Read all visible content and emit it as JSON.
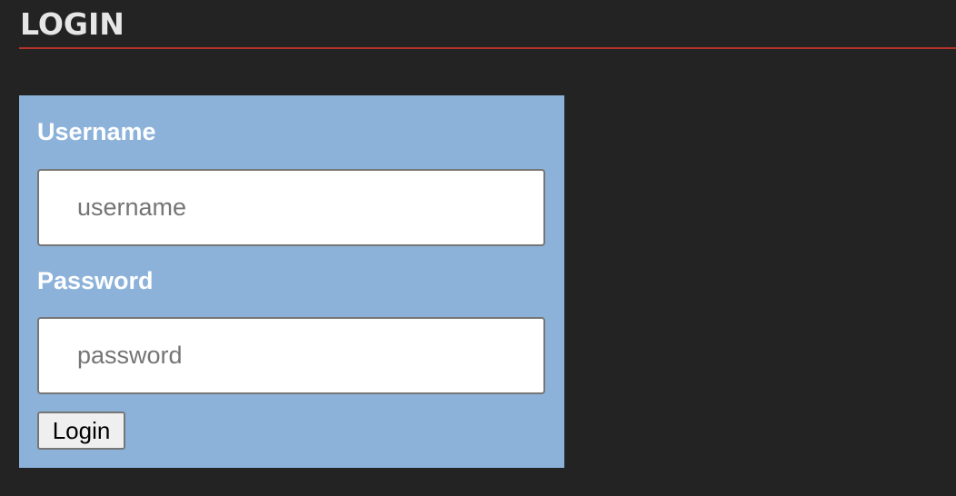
{
  "header": {
    "title": "LOGIN"
  },
  "form": {
    "username": {
      "label": "Username",
      "placeholder": "username",
      "value": ""
    },
    "password": {
      "label": "Password",
      "placeholder": "password",
      "value": ""
    },
    "submit_label": "Login"
  },
  "colors": {
    "background": "#232323",
    "panel": "#8cb2da",
    "header_rule": "#b5332b",
    "title_text": "#e6e6e6"
  }
}
